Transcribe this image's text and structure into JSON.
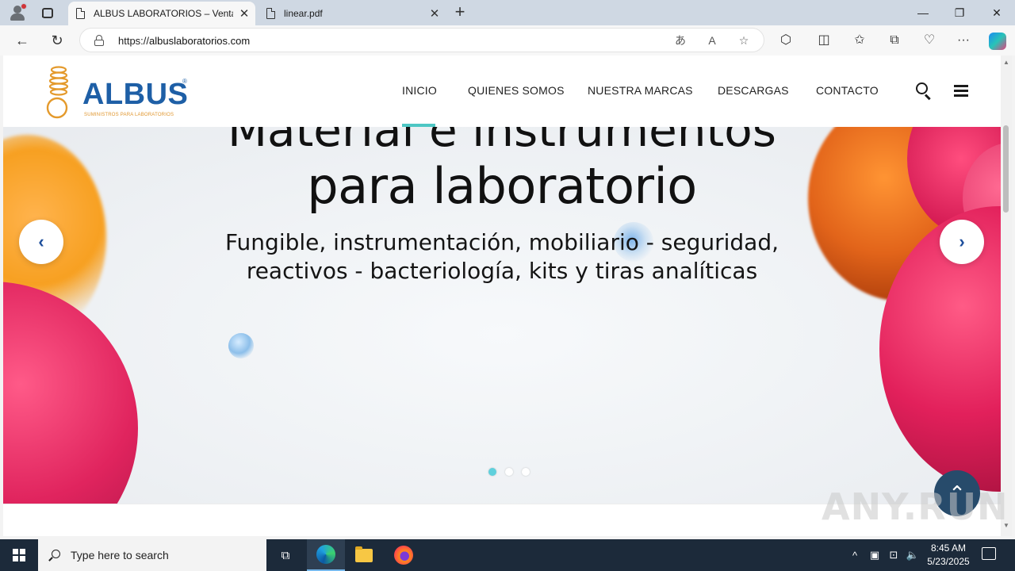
{
  "browser": {
    "tabs": [
      {
        "title": "ALBUS LABORATORIOS – Venta d",
        "active": true
      },
      {
        "title": "linear.pdf",
        "active": false
      }
    ],
    "url_prefix": "https://",
    "url_host": "albuslaboratorios.com"
  },
  "site": {
    "logo": {
      "brand": "ALBUS",
      "reg": "®",
      "tagline": "SUMINISTROS PARA LABORATORIOS"
    },
    "nav": [
      {
        "label": "INICIO",
        "active": true
      },
      {
        "label": "QUIENES SOMOS",
        "active": false
      },
      {
        "label": "NUESTRA MARCAS",
        "active": false
      },
      {
        "label": "DESCARGAS",
        "active": false
      },
      {
        "label": "CONTACTO",
        "active": false
      }
    ],
    "hero": {
      "line1": "Material e instrumentos",
      "line2": "para laboratorio",
      "sub1": "Fungible, instrumentación, mobiliario - seguridad,",
      "sub2": "reactivos - bacteriología, kits y tiras analíticas",
      "slides": 3,
      "current_slide": 1
    },
    "accent_color": "#4dc7c4",
    "brand_color": "#1e5fa6"
  },
  "watermark": "ANY.RUN",
  "taskbar": {
    "search_placeholder": "Type here to search",
    "time": "8:45 AM",
    "date": "5/23/2025"
  }
}
